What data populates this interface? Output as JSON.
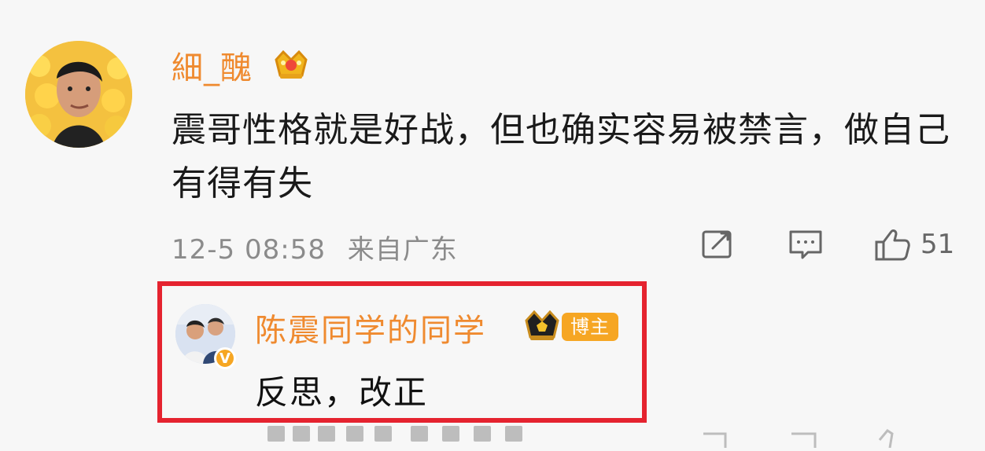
{
  "comment": {
    "username": "細_醜",
    "text": "震哥性格就是好战，但也确实容易被禁言，做自己有得有失",
    "timestamp": "12-5 08:58",
    "location": "来自广东",
    "like_count": "51",
    "icons": [
      "avatar",
      "vip-crown-icon",
      "share-icon",
      "reply-icon",
      "like-icon"
    ]
  },
  "reply": {
    "username": "陈震同学的同学",
    "badge": "博主",
    "text": "反思，改正",
    "verified_badge": "V",
    "icons": [
      "avatar",
      "verified-badge-icon",
      "vip-crown-icon"
    ]
  },
  "colors": {
    "background": "#f7f7f7",
    "username": "#ef8a2f",
    "highlight_box": "#e5232f",
    "meta_text": "#8b8b8b",
    "badge": "#f6a623"
  }
}
